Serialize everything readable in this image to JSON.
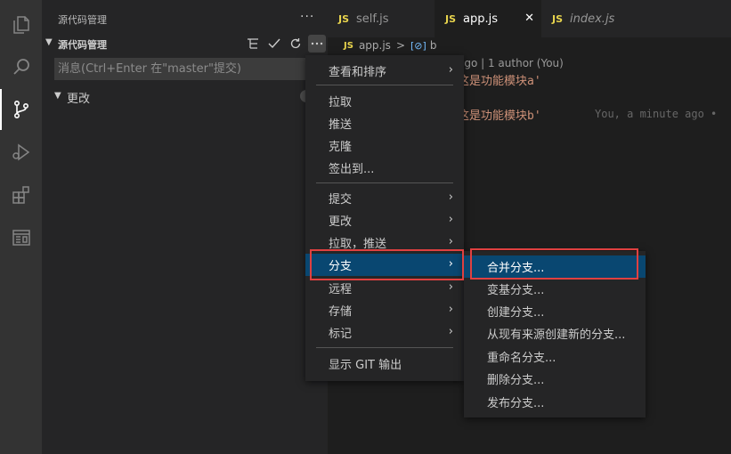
{
  "activity_bar": {
    "icons": [
      "explorer-icon",
      "search-icon",
      "source-control-icon",
      "run-debug-icon",
      "extensions-icon",
      "remote-explorer-icon"
    ]
  },
  "sidebar": {
    "title": "源代码管理",
    "more": "···",
    "section_title": "源代码管理",
    "commit_placeholder": "消息(Ctrl+Enter 在\"master\"提交)",
    "changes_label": "更改"
  },
  "tabs": [
    {
      "icon": "JS",
      "label": "self.js"
    },
    {
      "icon": "JS",
      "label": "app.js",
      "close": "✕"
    },
    {
      "icon": "JS",
      "label": "index.js"
    }
  ],
  "editor": {
    "breadcrumb": {
      "file_icon": "JS",
      "file": "app.js",
      "separator": ">",
      "symbol_icon": "[⊘]",
      "symbol": "b"
    },
    "codelens": "ago | 1 author (You)",
    "lines": [
      "这是功能模块a'",
      "这是功能模块b'"
    ],
    "blame": "You, a minute ago •"
  },
  "context_menu": {
    "items": [
      {
        "label": "查看和排序",
        "submenu": true
      },
      {
        "label": "拉取"
      },
      {
        "label": "推送"
      },
      {
        "label": "克隆"
      },
      {
        "label": "签出到..."
      },
      {
        "label": "提交",
        "submenu": true
      },
      {
        "label": "更改",
        "submenu": true
      },
      {
        "label": "拉取，推送",
        "submenu": true
      },
      {
        "label": "分支",
        "submenu": true,
        "selected": true
      },
      {
        "label": "远程",
        "submenu": true
      },
      {
        "label": "存储",
        "submenu": true
      },
      {
        "label": "标记",
        "submenu": true
      },
      {
        "label": "显示 GIT 输出"
      }
    ]
  },
  "branch_submenu": {
    "items": [
      {
        "label": "合并分支...",
        "selected": true
      },
      {
        "label": "变基分支..."
      },
      {
        "label": "创建分支..."
      },
      {
        "label": "从现有来源创建新的分支..."
      },
      {
        "label": "重命名分支..."
      },
      {
        "label": "删除分支..."
      },
      {
        "label": "发布分支..."
      }
    ]
  },
  "colors": {
    "accent_selected": "#094771",
    "highlight_border": "#e04040",
    "js_icon": "#e8d44d",
    "string": "#ce9178"
  }
}
